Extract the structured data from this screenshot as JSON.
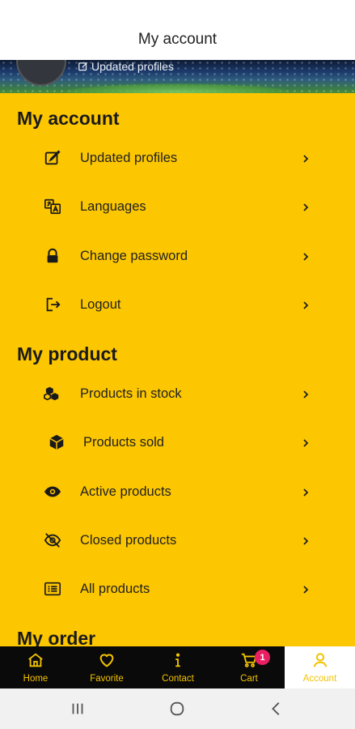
{
  "header": {
    "title": "My account"
  },
  "banner": {
    "edit_label": "Updated profiles"
  },
  "sections": [
    {
      "title": "My account",
      "items": [
        {
          "label": "Updated profiles",
          "icon": "edit-icon"
        },
        {
          "label": "Languages",
          "icon": "translate-icon"
        },
        {
          "label": "Change password",
          "icon": "lock-icon"
        },
        {
          "label": "Logout",
          "icon": "logout-icon"
        }
      ]
    },
    {
      "title": "My product",
      "items": [
        {
          "label": "Products in stock",
          "icon": "boxes-icon"
        },
        {
          "label": "Products sold",
          "icon": "box-icon"
        },
        {
          "label": "Active products",
          "icon": "eye-icon"
        },
        {
          "label": "Closed products",
          "icon": "eye-off-icon"
        },
        {
          "label": "All products",
          "icon": "list-icon"
        }
      ]
    },
    {
      "title": "My order",
      "items": []
    }
  ],
  "tabs": [
    {
      "label": "Home",
      "icon": "home-icon"
    },
    {
      "label": "Favorite",
      "icon": "heart-icon"
    },
    {
      "label": "Contact",
      "icon": "info-icon"
    },
    {
      "label": "Cart",
      "icon": "cart-icon",
      "badge": "1"
    },
    {
      "label": "Account",
      "icon": "user-icon",
      "active": true
    }
  ],
  "colors": {
    "primary": "#fcc600",
    "tabbar": "#0a0a0a",
    "tab_text": "#f3c300",
    "badge": "#e91e63"
  }
}
